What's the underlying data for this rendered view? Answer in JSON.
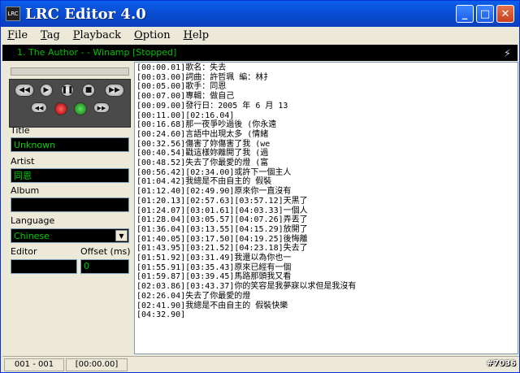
{
  "window": {
    "title": "LRC Editor 4.0",
    "icon_text": "LRC",
    "minimize_glyph": "_",
    "maximize_glyph": "□",
    "close_glyph": "✕"
  },
  "menu": [
    {
      "underline": "F",
      "rest": "ile"
    },
    {
      "underline": "T",
      "rest": "ag"
    },
    {
      "underline": "P",
      "rest": "layback"
    },
    {
      "underline": "O",
      "rest": "ption"
    },
    {
      "underline": "H",
      "rest": "elp"
    }
  ],
  "winamp": {
    "status": "1. The Author -  - Winamp [Stopped]",
    "logo_glyph": "⚡"
  },
  "controls": {
    "prev": "◀◀",
    "play": "▶",
    "pause": "❚❚",
    "stop": "■",
    "next": "▶▶",
    "back": "◀◀",
    "forward": "▶▶"
  },
  "fields": {
    "title_label": "Title",
    "title_value": "Unknown",
    "artist_label": "Artist",
    "artist_value": "同恩",
    "album_label": "Album",
    "album_value": "",
    "language_label": "Language",
    "language_value": "Chinese",
    "editor_label": "Editor",
    "editor_value": "",
    "offset_label": "Offset (ms)",
    "offset_value": "0"
  },
  "lyrics": [
    "[00:00.01]歌名：失去",
    "[00:03.00]詞曲：許哲珮  編：林扌",
    "[00:05.00]歌手：同恩",
    "[00:07.00]專輯：做自己",
    "[00:09.00]發行日：2005 年 6 月 13",
    "[00:11.00][02:16.04]",
    "[00:16.68]那一夜爭吵過後  (你永遠",
    "[00:24.60]言語中出現太多  (情緒",
    "[00:32.56]傷害了妳傷害了我  (we",
    "[00:40.54]戳這樣妳離開了我  (過",
    "[00:48.52]失去了你最愛的燈  (富",
    "[00:56.42][02:34.00]或許下一個主人",
    "[01:04.42]我總是不由自主的  假裝",
    "[01:12.40][02:49.90]原來你一直沒有",
    "[01:20.13][02:57.63][03:57.12]天黑了",
    "[01:24.07][03:01.61][04:03.33]一個人",
    "[01:28.04][03:05.57][04:07.26]弄丟了",
    "[01:36.04][03:13.55][04:15.29]放開了",
    "[01:40.05][03:17.50][04:19.25]後悔離",
    "[01:43.95][03:21.52][04:23.18]失去了",
    "[01:51.92][03:31.49]我還以為你也一",
    "[01:55.91][03:35.43]原來已經有一個",
    "[01:59.87][03:39.45]馬路那頭我又看",
    "[02:03.86][03:43.37]你的笑容是我夢寐以求但是我沒有",
    "[02:26.04]失去了你最愛的燈",
    "[02:41.90]我總是不由自主的  假裝快樂",
    "[04:32.90]"
  ],
  "status": {
    "line_counter": "001 - 001",
    "time": "[00:00.00]"
  },
  "watermark": "#7036"
}
